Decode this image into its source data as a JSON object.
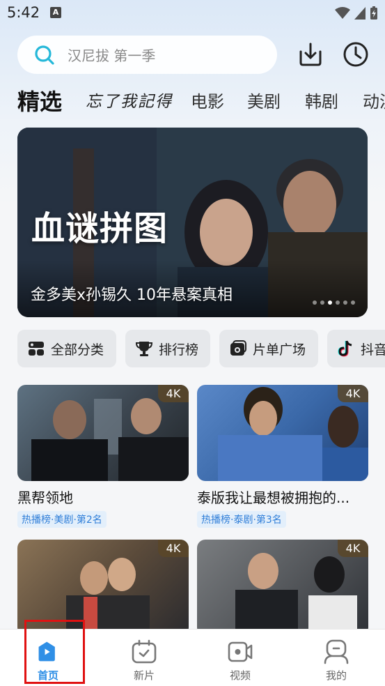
{
  "status": {
    "time": "5:42",
    "notif_icon": "A"
  },
  "search": {
    "placeholder": "汉尼拔 第一季"
  },
  "top_icons": [
    "download-icon",
    "history-icon"
  ],
  "tabs": [
    "精选",
    "忘了我記得",
    "电影",
    "美剧",
    "韩剧",
    "动漫"
  ],
  "banner": {
    "title": "血谜拼图",
    "caption": "金多美x孙锡久 10年悬案真相",
    "dots": 6,
    "active_dot": 3
  },
  "categories": [
    {
      "label": "全部分类",
      "icon": "grid-icon"
    },
    {
      "label": "排行榜",
      "icon": "trophy-icon"
    },
    {
      "label": "片单广场",
      "icon": "playlist-icon"
    },
    {
      "label": "抖音",
      "icon": "tiktok-icon"
    }
  ],
  "cards": [
    {
      "title": "黑帮领地",
      "badge": "4K",
      "tag": "热播榜·美剧·第2名",
      "colors": [
        "#4a5a66",
        "#2a3036"
      ]
    },
    {
      "title": "泰版我让最想被拥抱的...",
      "badge": "4K",
      "tag": "热播榜·泰剧·第3名",
      "colors": [
        "#3f6fb4",
        "#1f3f73"
      ]
    },
    {
      "title": "",
      "badge": "4K",
      "tag": "",
      "colors": [
        "#6b5a48",
        "#2a2a2e"
      ]
    },
    {
      "title": "",
      "badge": "4K",
      "tag": "",
      "colors": [
        "#5b5e60",
        "#2c2f33"
      ]
    }
  ],
  "nav": [
    {
      "label": "首页",
      "icon": "home-icon",
      "active": true
    },
    {
      "label": "新片",
      "icon": "calendar-check-icon",
      "active": false
    },
    {
      "label": "视频",
      "icon": "video-icon",
      "active": false
    },
    {
      "label": "我的",
      "icon": "profile-icon",
      "active": false
    }
  ],
  "accent": "#2f8fe6"
}
